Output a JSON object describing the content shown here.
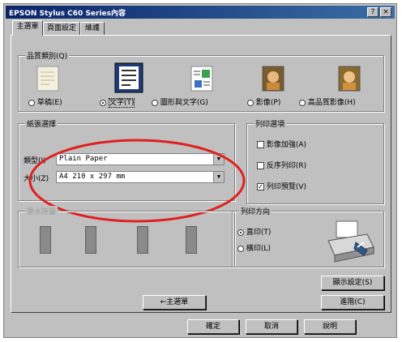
{
  "window": {
    "title": "EPSON Stylus C60 Series內容",
    "help_glyph": "?",
    "close_glyph": "×"
  },
  "tabs": [
    "主選單",
    "頁面設定",
    "維護"
  ],
  "media_section": {
    "label": "品質類別(Q)",
    "options": [
      "草稿(E)",
      "文字(T)",
      "圖形與文字(G)",
      "影像(P)",
      "高品質影像(H)"
    ],
    "selected": 1
  },
  "paper_section": {
    "label": "紙張選擇",
    "type_label": "類型(I)",
    "type_value": "Plain Paper",
    "size_label": "大小(Z)",
    "size_value": "A4 210 x 297 mm"
  },
  "ink_section": {
    "label": "墨水存量"
  },
  "print_options": {
    "label": "列印選項",
    "items": [
      {
        "label": "影像加強(A)",
        "checked": false
      },
      {
        "label": "反序列印(R)",
        "checked": false
      },
      {
        "label": "列印預覽(V)",
        "checked": true
      }
    ]
  },
  "orientation": {
    "label": "列印方向",
    "options": [
      "直印(T)",
      "橫印(L)"
    ],
    "selected": 0
  },
  "buttons": {
    "show_settings": "顯示設定(S)",
    "advanced": "進階(C)",
    "back": "←主選單",
    "ok": "確定",
    "cancel": "取消",
    "help": "說明"
  },
  "highlight_color": "#e02020"
}
